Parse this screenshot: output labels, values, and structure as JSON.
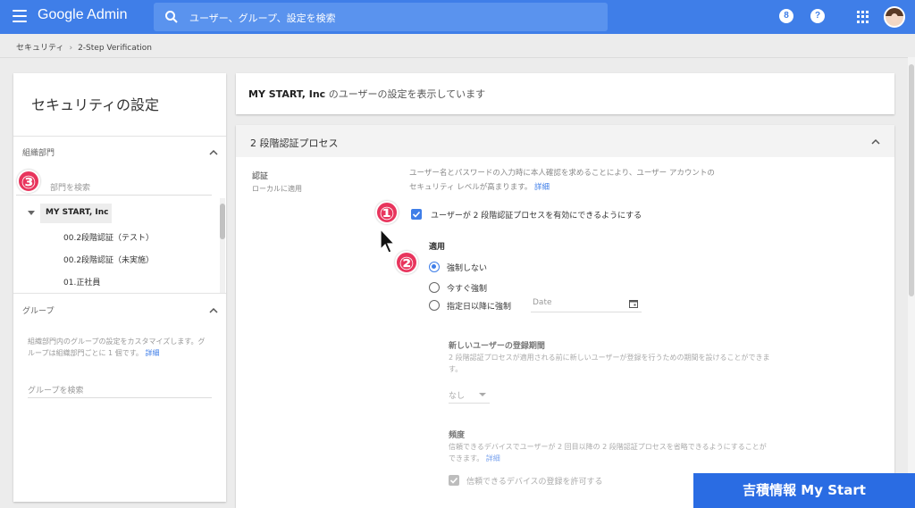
{
  "header": {
    "brand_google": "Google",
    "brand_admin": "Admin",
    "search_placeholder": "ユーザー、グループ、設定を検索",
    "notification_icon_glyph": "8",
    "help_icon_glyph": "?"
  },
  "breadcrumb": {
    "parent": "セキュリティ",
    "separator": "›",
    "current": "2-Step Verification"
  },
  "left": {
    "title": "セキュリティの設定",
    "org_section_label": "組織部門",
    "org_search_placeholder": "部門を検索",
    "org_root": "MY START, Inc",
    "org_children": [
      "00.2段階認証（テスト）",
      "00.2段階認証（未実施）",
      "01.正社員"
    ],
    "group_section_label": "グループ",
    "group_desc": "組織部門内のグループの設定をカスタマイズします。グループは組織部門ごとに 1 個です。",
    "group_desc_link": "詳細",
    "group_search_placeholder": "グループを検索"
  },
  "info": {
    "org_name": "MY START, Inc",
    "suffix": " のユーザーの設定を表示しています"
  },
  "main": {
    "section_title": "2 段階認証プロセス",
    "setting_label": "認証",
    "setting_sub": "ローカルに適用",
    "description": "ユーザー名とパスワードの入力時に本人確認を求めることにより、ユーザー アカウントのセキュリティ レベルが高まります。",
    "description_link": "詳細",
    "checkbox_label": "ユーザーが 2 段階認証プロセスを有効にできるようにする",
    "checkbox_checked": true,
    "apply_label": "適用",
    "radio_options": [
      "強制しない",
      "今すぐ強制",
      "指定日以降に強制"
    ],
    "radio_selected": 0,
    "date_placeholder": "Date",
    "enroll_title": "新しいユーザーの登録期間",
    "enroll_desc": "2 段階認証プロセスが適用される前に新しいユーザーが登録を行うための期間を設けることができます。",
    "enroll_select": "なし",
    "freq_title": "頻度",
    "freq_desc": "信頼できるデバイスでユーザーが 2 回目以降の 2 段階認証プロセスを省略できるようにすることができます。",
    "freq_desc_link": "詳細",
    "trusted_label": "信頼できるデバイスの登録を許可する",
    "trusted_checked": true
  },
  "annotations": {
    "step1": "①",
    "step2": "②",
    "step3": "③",
    "badge_color": "#e8355d"
  },
  "banner": {
    "text": "吉積情報 My Start"
  },
  "colors": {
    "topbar": "#3f7ee8",
    "accent": "#3f7ee8",
    "banner": "#2a6ce3"
  }
}
